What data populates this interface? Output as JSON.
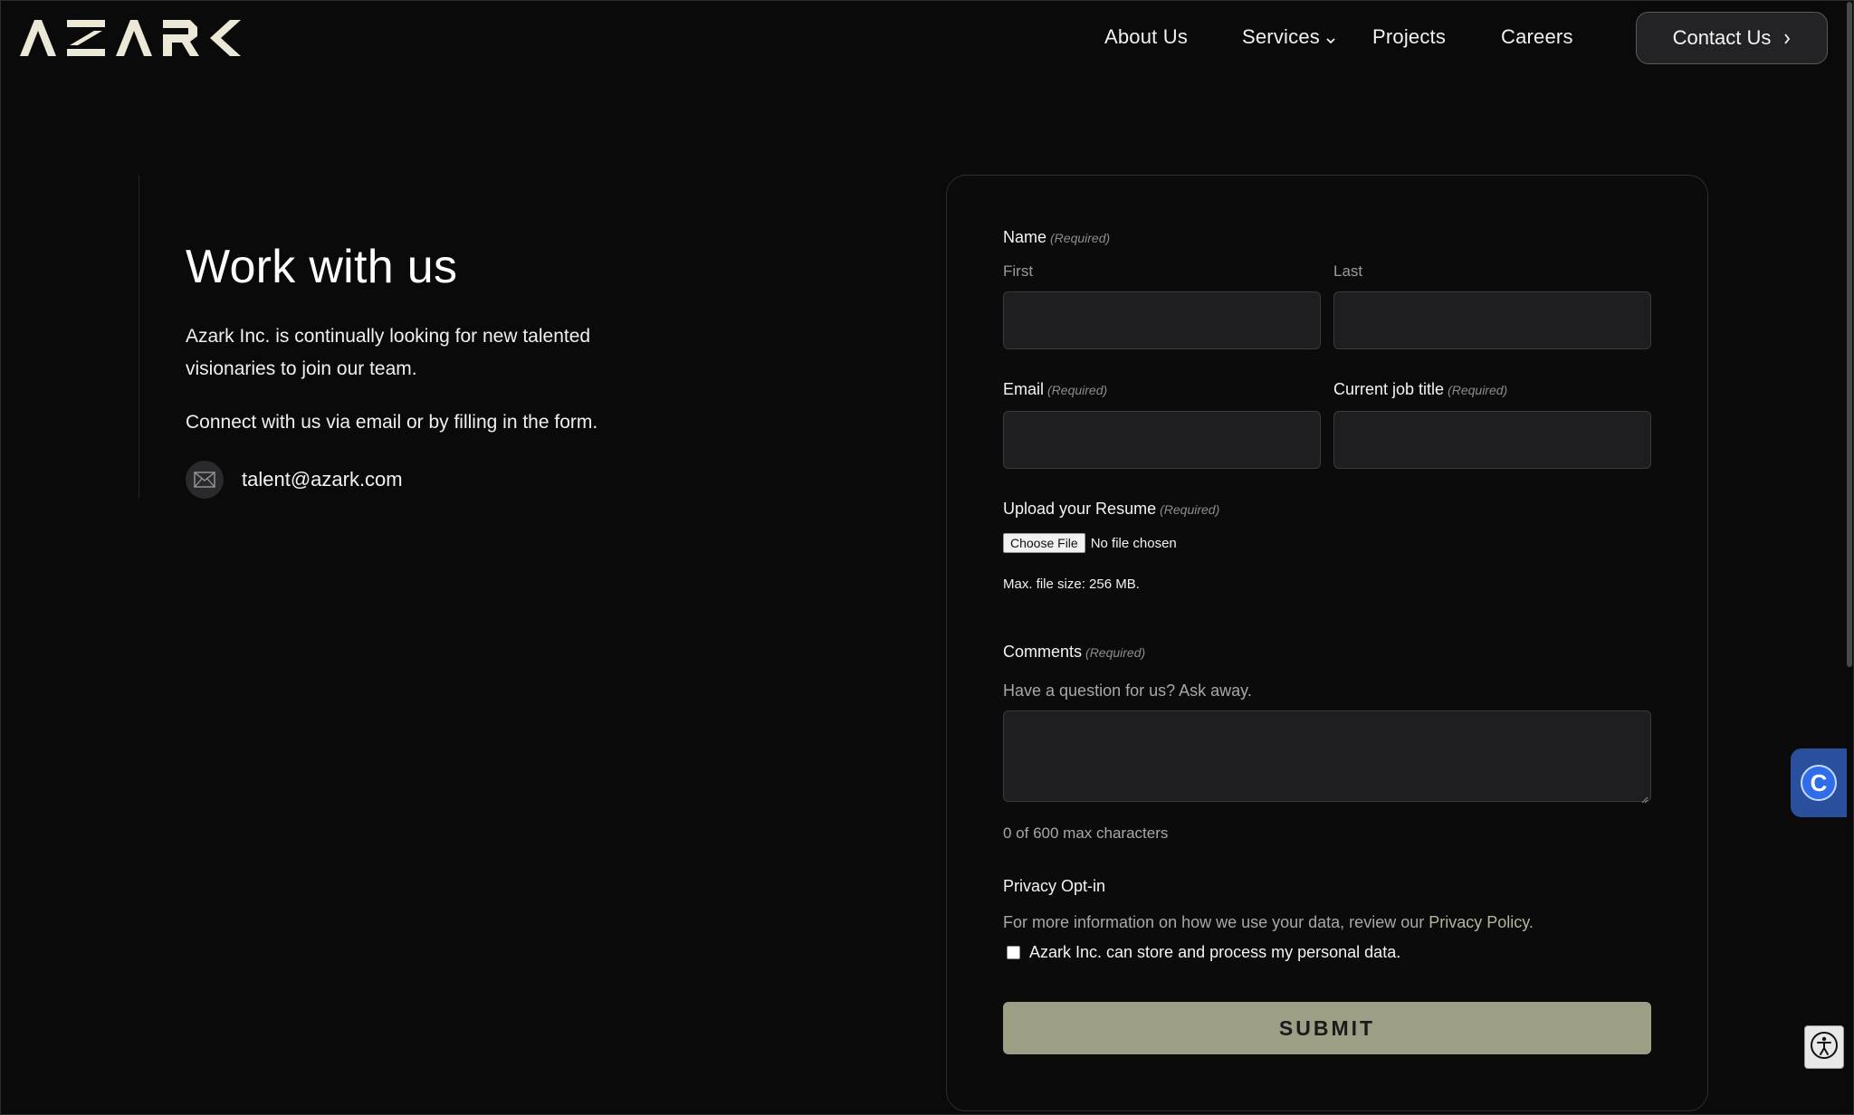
{
  "header": {
    "logo_text": "AZARK",
    "nav": {
      "about": "About Us",
      "services": "Services",
      "projects": "Projects",
      "careers": "Careers"
    },
    "contact_button": "Contact Us"
  },
  "intro": {
    "title": "Work with us",
    "paragraph": "Azark Inc. is continually looking for new talented visionaries to join our team.",
    "connect": "Connect with us via email or by filling in the form.",
    "email": "talent@azark.com"
  },
  "form": {
    "required_tag": "(Required)",
    "name": {
      "label": "Name",
      "first_label": "First",
      "last_label": "Last",
      "first_value": "",
      "last_value": ""
    },
    "email": {
      "label": "Email",
      "value": ""
    },
    "job_title": {
      "label": "Current job title",
      "value": ""
    },
    "resume": {
      "label": "Upload your Resume",
      "choose_button": "Choose File",
      "file_status": "No file chosen",
      "max_size": "Max. file size: 256 MB."
    },
    "comments": {
      "label": "Comments",
      "hint": "Have a question for us? Ask away.",
      "value": "",
      "counter": "0 of 600 max characters"
    },
    "privacy": {
      "label": "Privacy Opt-in",
      "info_prefix": "For more information on how we use your data, review our ",
      "info_link": "Privacy Policy",
      "info_suffix": ".",
      "consent_text": "Azark Inc. can store and process my personal data.",
      "consent_checked": false
    },
    "submit": "SUBMIT"
  },
  "widgets": {
    "chat_icon_letter": "C",
    "accessibility_icon": "accessibility-icon"
  },
  "colors": {
    "background": "#0a0a0b",
    "accent": "#9c9f84",
    "link": "#b4b69c",
    "chat_blue": "#2f6ee8"
  }
}
